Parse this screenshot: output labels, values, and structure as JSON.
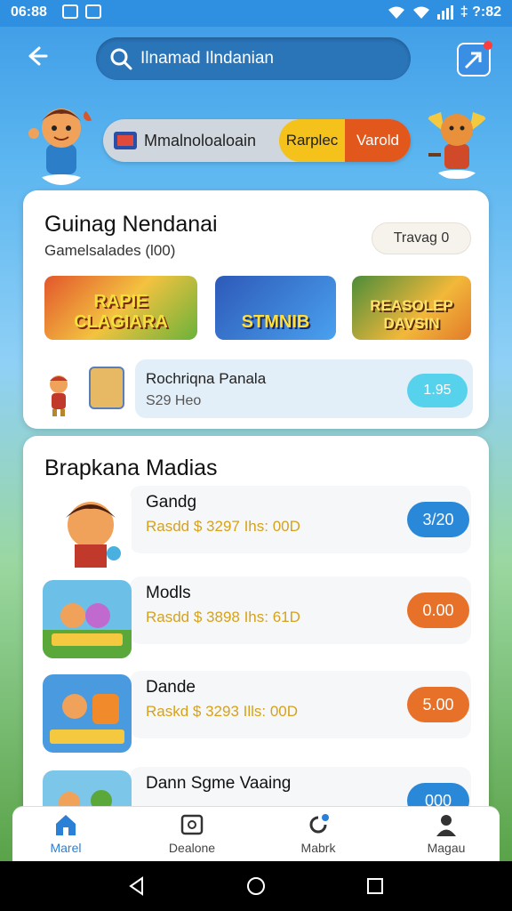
{
  "status": {
    "time": "06:88",
    "right": "‡ ?:82"
  },
  "header": {
    "search_query": "Ilnamad Ilndanian"
  },
  "banner": {
    "label": "Mmalnoloaloain",
    "chip1": "Rarplec",
    "chip2": "Varold"
  },
  "featured": {
    "title": "Guinag Nendanai",
    "subtitle": "Gamelsalades (l00)",
    "pill": "Travag 0",
    "thumbs": [
      "RAPIE CLAGIARA",
      "STMNIB",
      "REASOLEP DAVSIN"
    ],
    "promo": {
      "name": "Rochriqna Panala",
      "price": "S29 Heo",
      "button": "1.95"
    }
  },
  "popular": {
    "title": "Brapkana Madias",
    "items": [
      {
        "name": "Gandg",
        "detail": "Rasdd $ 3297 Ihs: 00D",
        "button": "3/20",
        "color": "#2a88d8"
      },
      {
        "name": "Modls",
        "detail": "Rasdd $ 3898 Ihs: 61D",
        "button": "0.00",
        "color": "#e8712a"
      },
      {
        "name": "Dande",
        "detail": "Raskd $ 3293 Ills: 00D",
        "button": "5.00",
        "color": "#e8712a"
      },
      {
        "name": "Dann Sgme Vaaing",
        "detail": "",
        "button": "000",
        "color": "#2a88d8"
      }
    ]
  },
  "tabs": [
    "Marel",
    "Dealone",
    "Mabrk",
    "Magau"
  ]
}
